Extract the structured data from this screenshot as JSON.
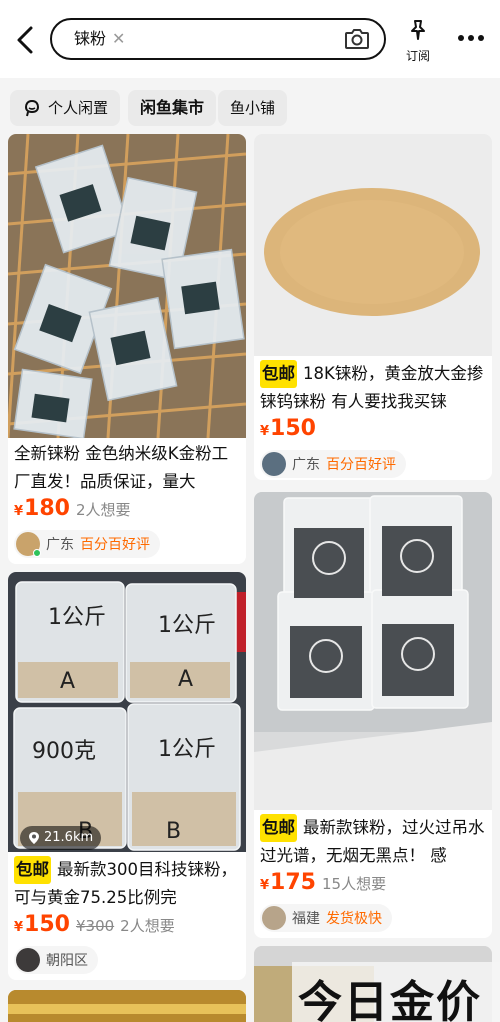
{
  "search": {
    "query": "铼粉"
  },
  "header": {
    "subscribe_label": "订阅"
  },
  "tabs": [
    {
      "label": "个人闲置"
    },
    {
      "label": "闲鱼集市"
    },
    {
      "label": "鱼小铺"
    }
  ],
  "listings": [
    {
      "title": "全新铼粉 金色纳米级K金粉工厂直发！品质保证，量大",
      "price": "180",
      "wants": "2人想要",
      "location": "广东",
      "badge": "百分百好评"
    },
    {
      "free_shipping": "包邮",
      "title": "18K铼粉，黄金放大金掺铼钨铼粉 有人要找我买铼",
      "price": "150",
      "location": "广东",
      "badge": "百分百好评"
    },
    {
      "distance": "21.6km",
      "free_shipping": "包邮",
      "title": "最新款300目科技铼粉，可与黄金75.25比例完",
      "price": "150",
      "original_price": "¥300",
      "wants": "2人想要",
      "location": "朝阳区",
      "photo_labels": [
        "1公斤",
        "A",
        "1公斤",
        "A",
        "900克",
        "1公斤",
        "B",
        "B"
      ]
    },
    {
      "free_shipping": "包邮",
      "title": "最新款铼粉，过火过吊水过光谱，无烟无黑点！ 感",
      "price": "175",
      "wants": "15人想要",
      "location": "福建",
      "badge": "发货极快"
    }
  ],
  "watermark": "今日金价",
  "colors": {
    "price": "#ff4400",
    "badge": "#ff6a00",
    "free_shipping": "#ffe100",
    "online": "#2ec25a"
  }
}
